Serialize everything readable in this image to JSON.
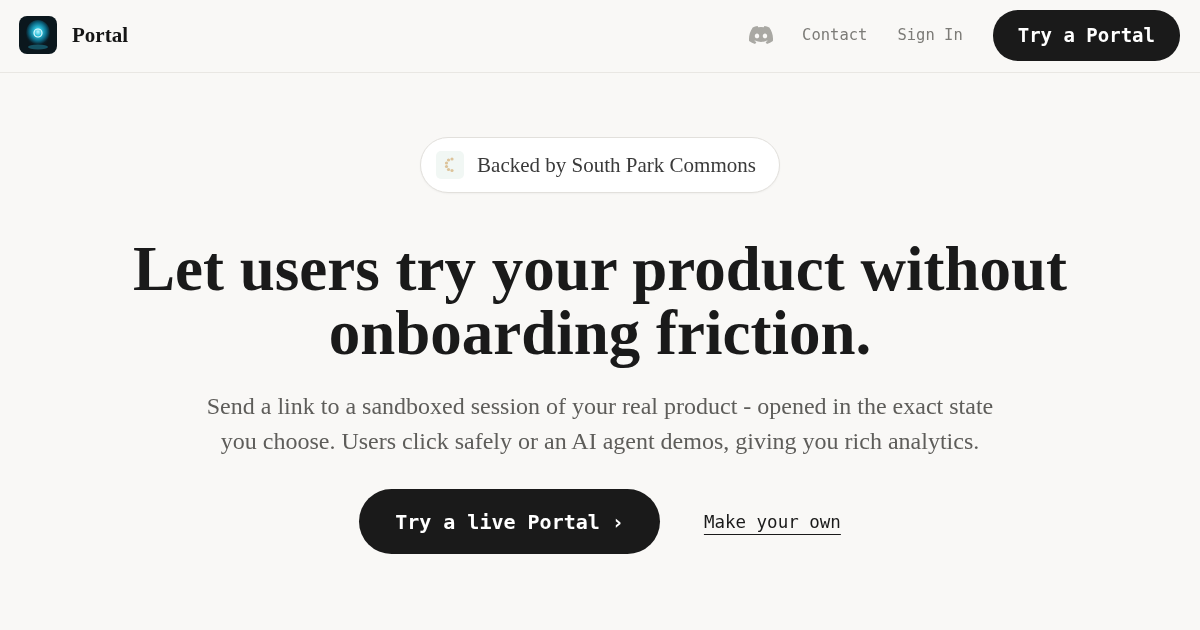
{
  "header": {
    "brand": "Portal",
    "nav_links": [
      "Contact",
      "Sign In"
    ],
    "cta": "Try a Portal"
  },
  "hero": {
    "badge": "Backed by South Park Commons",
    "headline": "Let users try your product without onboarding friction.",
    "subtitle": "Send a link to a sandboxed session of your real product - opened in the exact state you choose. Users click safely or an AI agent demos, giving you rich analytics.",
    "primary_button": "Try a live Portal ›",
    "secondary_link": "Make your own"
  }
}
